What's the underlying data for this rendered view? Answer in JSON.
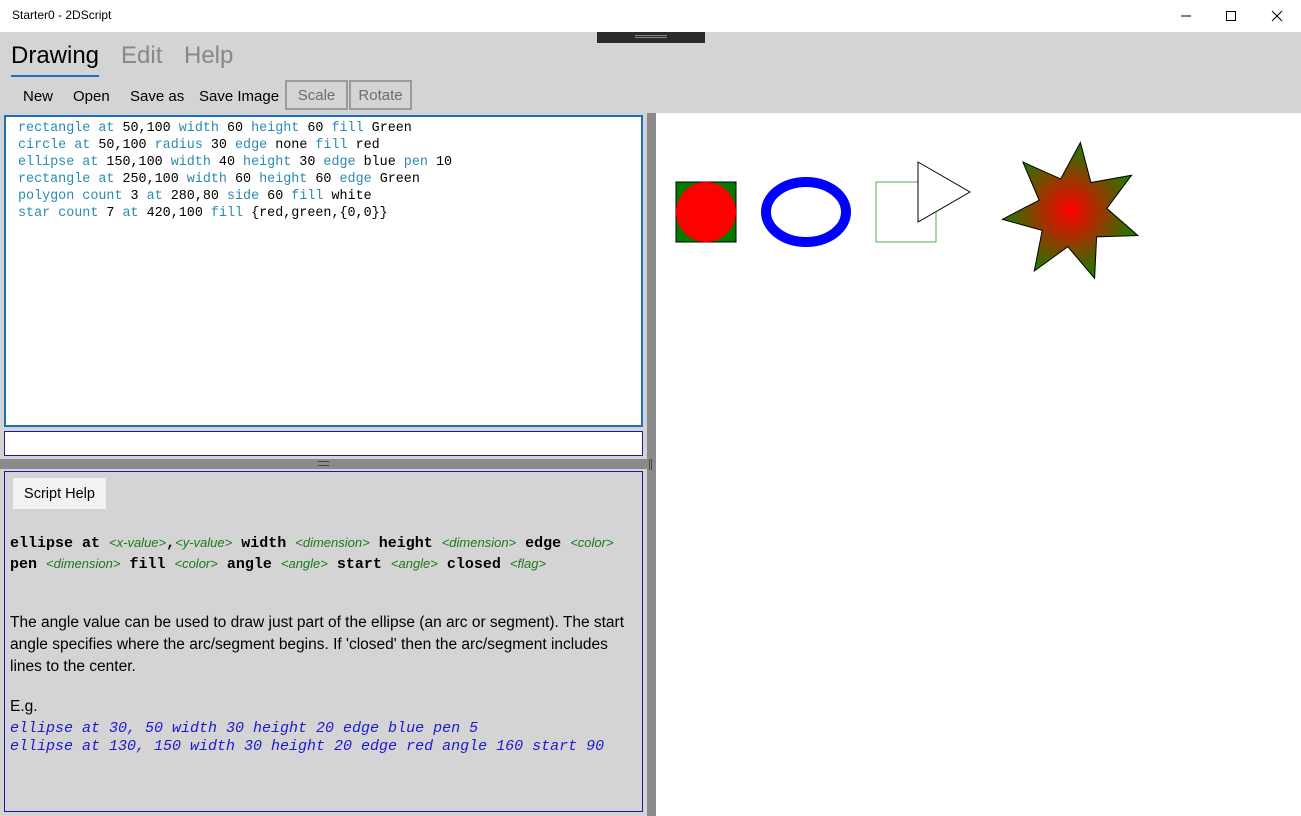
{
  "window": {
    "title": "Starter0 - 2DScript",
    "minimize_icon": "minimize-icon",
    "maximize_icon": "maximize-icon",
    "close_icon": "close-icon"
  },
  "tabs": [
    {
      "label": "Drawing",
      "active": true
    },
    {
      "label": "Edit",
      "active": false
    },
    {
      "label": "Help",
      "active": false
    }
  ],
  "commands": {
    "new": "New",
    "open": "Open",
    "save_as": "Save as",
    "save_image": "Save Image",
    "scale": "Scale",
    "rotate": "Rotate"
  },
  "script_lines": [
    [
      [
        "kw",
        "rectangle"
      ],
      [
        "t",
        " "
      ],
      [
        "kw",
        "at"
      ],
      [
        "t",
        " 50,100 "
      ],
      [
        "kw",
        "width"
      ],
      [
        "t",
        " 60 "
      ],
      [
        "kw",
        "height"
      ],
      [
        "t",
        " 60 "
      ],
      [
        "kw",
        "fill"
      ],
      [
        "t",
        " Green"
      ]
    ],
    [
      [
        "kw",
        "circle"
      ],
      [
        "t",
        " "
      ],
      [
        "kw",
        "at"
      ],
      [
        "t",
        " 50,100 "
      ],
      [
        "kw",
        "radius"
      ],
      [
        "t",
        " 30 "
      ],
      [
        "kw",
        "edge"
      ],
      [
        "t",
        " none "
      ],
      [
        "kw",
        "fill"
      ],
      [
        "t",
        " red"
      ]
    ],
    [
      [
        "kw",
        "ellipse"
      ],
      [
        "t",
        " "
      ],
      [
        "kw",
        "at"
      ],
      [
        "t",
        " 150,100 "
      ],
      [
        "kw",
        "width"
      ],
      [
        "t",
        " 40 "
      ],
      [
        "kw",
        "height"
      ],
      [
        "t",
        " 30 "
      ],
      [
        "kw",
        "edge"
      ],
      [
        "t",
        " blue "
      ],
      [
        "kw",
        "pen"
      ],
      [
        "t",
        " 10"
      ]
    ],
    [
      [
        "kw",
        "rectangle"
      ],
      [
        "t",
        " "
      ],
      [
        "kw",
        "at"
      ],
      [
        "t",
        " 250,100 "
      ],
      [
        "kw",
        "width"
      ],
      [
        "t",
        " 60 "
      ],
      [
        "kw",
        "height"
      ],
      [
        "t",
        " 60 "
      ],
      [
        "kw",
        "edge"
      ],
      [
        "t",
        " Green"
      ]
    ],
    [
      [
        "kw",
        "polygon"
      ],
      [
        "t",
        " "
      ],
      [
        "kw",
        "count"
      ],
      [
        "t",
        " 3 "
      ],
      [
        "kw",
        "at"
      ],
      [
        "t",
        " 280,80 "
      ],
      [
        "kw",
        "side"
      ],
      [
        "t",
        " 60 "
      ],
      [
        "kw",
        "fill"
      ],
      [
        "t",
        " white"
      ]
    ],
    [
      [
        "kw",
        "star"
      ],
      [
        "t",
        " "
      ],
      [
        "kw",
        "count"
      ],
      [
        "t",
        " 7 "
      ],
      [
        "kw",
        "at"
      ],
      [
        "t",
        " 420,100 "
      ],
      [
        "kw",
        "fill"
      ],
      [
        "t",
        " {red,green,{0,0}}"
      ]
    ]
  ],
  "command_input": {
    "value": ""
  },
  "help": {
    "button_label": "Script Help",
    "syntax": [
      [
        "k",
        "ellipse at "
      ],
      [
        "p",
        "<x-value>"
      ],
      [
        "k",
        ","
      ],
      [
        "p",
        "<y-value>"
      ],
      [
        "k",
        " width "
      ],
      [
        "p",
        "<dimension>"
      ],
      [
        "k",
        " height "
      ],
      [
        "p",
        "<dimension>"
      ],
      [
        "k",
        " edge "
      ],
      [
        "p",
        "<color>"
      ],
      [
        "k",
        " pen "
      ],
      [
        "p",
        "<dimension>"
      ],
      [
        "k",
        " fill "
      ],
      [
        "p",
        "<color>"
      ],
      [
        "k",
        " angle "
      ],
      [
        "p",
        "<angle>"
      ],
      [
        "k",
        " start "
      ],
      [
        "p",
        "<angle>"
      ],
      [
        "k",
        " closed "
      ],
      [
        "p",
        "<flag>"
      ]
    ],
    "description": "The angle value can be used to draw just part of the ellipse (an arc or segment). The start angle specifies where the arc/segment begins. If 'closed' then the arc/segment includes lines to the center.",
    "eg_label": "E.g.",
    "examples": [
      "ellipse at 30, 50 width 30 height 20 edge blue pen 5",
      "ellipse at 130, 150 width 30 height 20 edge red angle 160 start 90"
    ]
  },
  "colors": {
    "accent": "#1e6fc0",
    "keyword": "#2a8bb1",
    "param": "#1a7a1a",
    "example": "#1a1ad0",
    "green": "#007a00",
    "red": "#ff0000",
    "blue": "#0000ff"
  }
}
